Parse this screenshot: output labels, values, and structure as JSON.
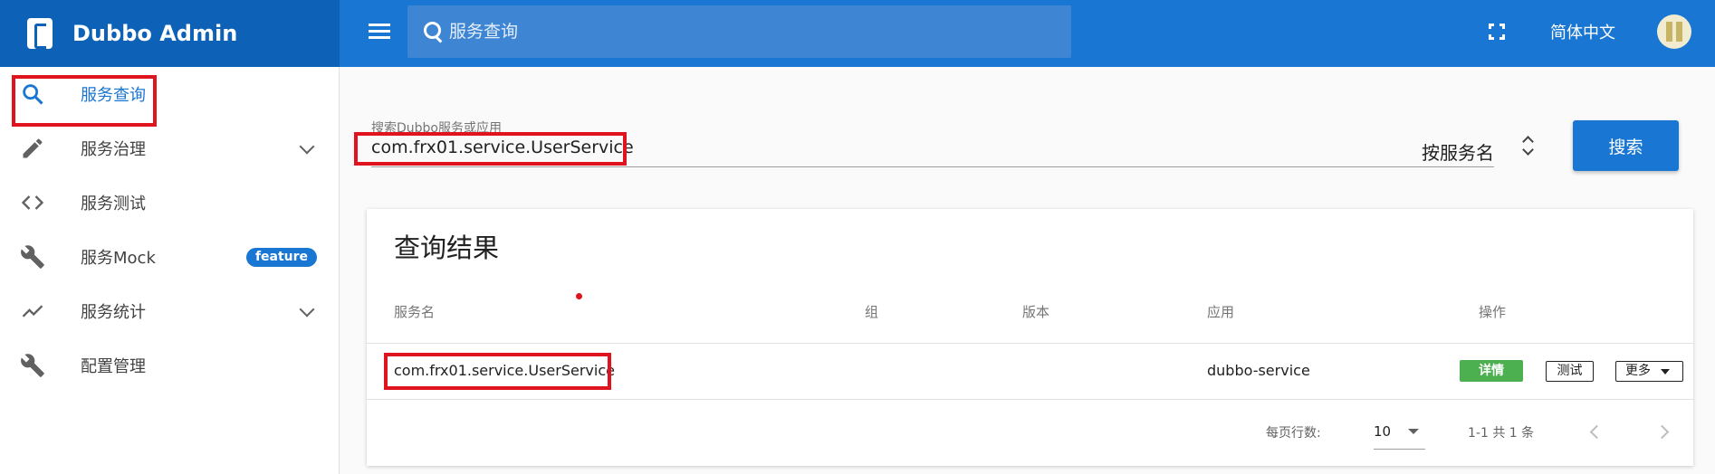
{
  "app": {
    "title": "Dubbo Admin"
  },
  "header": {
    "search_placeholder": "服务查询",
    "language": "简体中文"
  },
  "sidebar": {
    "items": [
      {
        "label": "服务查询",
        "icon": "search-icon",
        "active": true
      },
      {
        "label": "服务治理",
        "icon": "pencil-icon",
        "expandable": true
      },
      {
        "label": "服务测试",
        "icon": "code-icon"
      },
      {
        "label": "服务Mock",
        "icon": "wrench-icon",
        "badge": "feature"
      },
      {
        "label": "服务统计",
        "icon": "trending-icon",
        "expandable": true
      },
      {
        "label": "配置管理",
        "icon": "wrench-icon"
      }
    ]
  },
  "search": {
    "hint": "搜索Dubbo服务或应用",
    "value": "com.frx01.service.UserService",
    "type": "按服务名",
    "button": "搜索"
  },
  "results": {
    "title": "查询结果",
    "columns": [
      "服务名",
      "组",
      "版本",
      "应用",
      "操作"
    ],
    "rows": [
      {
        "service": "com.frx01.service.UserService",
        "group": "",
        "version": "",
        "app": "dubbo-service"
      }
    ],
    "actions": {
      "detail": "详情",
      "test": "测试",
      "more": "更多"
    },
    "footer": {
      "rows_per_page_label": "每页行数:",
      "rows_per_page": "10",
      "page_info": "1-1 共 1 条"
    }
  },
  "colors": {
    "primary": "#1976d2",
    "brand_bg": "#0d62b8",
    "detail_green": "#4caf50",
    "highlight_red": "#e0141e"
  }
}
